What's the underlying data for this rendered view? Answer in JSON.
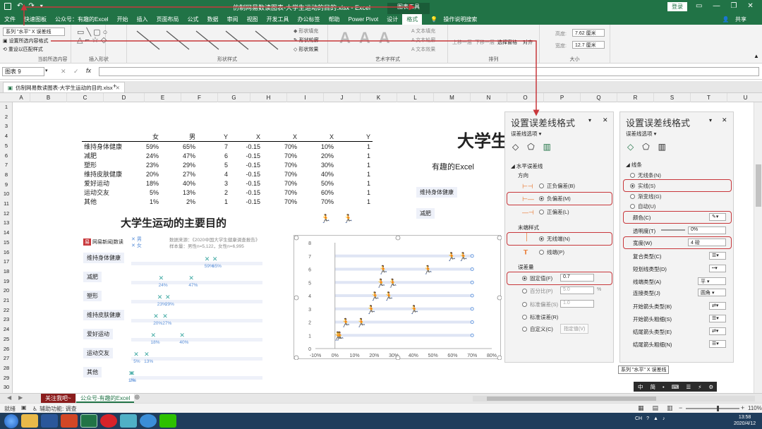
{
  "window": {
    "title": "仿制网易数读图表-大学生运动的目的.xlsx  -  Excel",
    "context_tab": "图表工具",
    "login": "登录",
    "share": "共享"
  },
  "menu": [
    "文件",
    "快速图板",
    "公众号：有趣的Excel",
    "开始",
    "插入",
    "页面布局",
    "公式",
    "数据",
    "审阅",
    "视图",
    "开发工具",
    "办公标签",
    "帮助",
    "Power Pivot",
    "设计",
    "格式",
    "操作说明搜索"
  ],
  "menu_active": "格式",
  "ribbon": {
    "selector": "系列 \"水平\" X 误差线",
    "sel_btn1": "设置所选内容格式",
    "sel_btn2": "重设以匹配样式",
    "grp_sel": "当前所选内容",
    "grp_insert": "插入形状",
    "grp_shape_style": "形状样式",
    "grp_art": "艺术字样式",
    "grp_arrange": "排列",
    "grp_size": "大小",
    "fill": "形状填充",
    "outline": "形状轮廓",
    "effect": "形状效果",
    "text_fill": "文本填充",
    "text_outline": "文本轮廓",
    "text_effect": "文本效果",
    "up": "上移一层",
    "down": "下移一层",
    "pane": "选择窗格",
    "align": "对齐",
    "height": "7.62 厘米",
    "width": "12.7 厘米",
    "h_lab": "高度:",
    "w_lab": "宽度:"
  },
  "namebox": "图表 9",
  "fx": "fx",
  "filetab": "仿制网易数读图表-大学生运动的目的.xlsx",
  "columns": [
    "A",
    "B",
    "C",
    "D",
    "E",
    "F",
    "G",
    "H",
    "I",
    "J",
    "K",
    "L",
    "M",
    "N",
    "O",
    "P",
    "Q",
    "R",
    "S",
    "T",
    "U"
  ],
  "rows": [
    "1",
    "2",
    "3",
    "4",
    "5",
    "6",
    "7",
    "8",
    "9",
    "10",
    "11",
    "12",
    "13",
    "14",
    "15",
    "16",
    "17",
    "18",
    "19",
    "20",
    "21",
    "22",
    "23",
    "24",
    "25",
    "26",
    "27",
    "28",
    "29",
    "30"
  ],
  "table": {
    "headers": [
      "",
      "女",
      "男",
      "Y",
      "X",
      "X",
      "X",
      "Y",
      ""
    ],
    "rows": [
      [
        "维持身体健康",
        "59%",
        "65%",
        "7",
        "-0.15",
        "70%",
        "10%",
        "1"
      ],
      [
        "减肥",
        "24%",
        "47%",
        "6",
        "-0.15",
        "70%",
        "20%",
        "1"
      ],
      [
        "塑形",
        "23%",
        "29%",
        "5",
        "-0.15",
        "70%",
        "30%",
        "1"
      ],
      [
        "维持皮肤健康",
        "20%",
        "27%",
        "4",
        "-0.15",
        "70%",
        "40%",
        "1"
      ],
      [
        "爱好运动",
        "18%",
        "40%",
        "3",
        "-0.15",
        "70%",
        "50%",
        "1"
      ],
      [
        "运动交友",
        "5%",
        "13%",
        "2",
        "-0.15",
        "70%",
        "60%",
        "1"
      ],
      [
        "其他",
        "1%",
        "2%",
        "1",
        "-0.15",
        "70%",
        "70%",
        "1"
      ]
    ]
  },
  "infographic": {
    "title": "大学生运动的主要目的",
    "brand": "网易新闻|数读",
    "legend_m": "男",
    "legend_f": "女",
    "source": "数据来源：《2020中国大学生健康调查报告》",
    "sample": "样本量：男性n=5,122，女性n=6,995",
    "cats": [
      {
        "name": "维持身体健康",
        "f": "59%",
        "m": "65%"
      },
      {
        "name": "减肥",
        "f": "24%",
        "m": "47%"
      },
      {
        "name": "塑形",
        "f": "23%",
        "m": "29%"
      },
      {
        "name": "维持皮肤健康",
        "f": "20%",
        "m": "27%"
      },
      {
        "name": "爱好运动",
        "f": "18%",
        "m": "40%"
      },
      {
        "name": "运动交友",
        "f": "5%",
        "m": "13%"
      },
      {
        "name": "其他",
        "f": "1%",
        "m": "2%"
      }
    ]
  },
  "right_preview": {
    "title": "大学生",
    "subtitle": "有趣的Excel",
    "cats": [
      "维持身体健康",
      "减肥"
    ]
  },
  "chart_data": {
    "type": "scatter",
    "xlim": [
      -0.1,
      0.8
    ],
    "ylim": [
      0,
      8
    ],
    "x_ticks": [
      "-10%",
      "0%",
      "10%",
      "20%",
      "30%",
      "40%",
      "50%",
      "60%",
      "70%",
      "80%"
    ],
    "y_ticks": [
      "0",
      "1",
      "2",
      "3",
      "4",
      "5",
      "6",
      "7",
      "8"
    ],
    "series": [
      {
        "name": "女",
        "x": [
          0.59,
          0.24,
          0.23,
          0.2,
          0.18,
          0.05,
          0.01
        ],
        "y": [
          7,
          6,
          5,
          4,
          3,
          2,
          1
        ]
      },
      {
        "name": "男",
        "x": [
          0.65,
          0.47,
          0.29,
          0.27,
          0.4,
          0.13,
          0.02
        ],
        "y": [
          7,
          6,
          5,
          4,
          3,
          2,
          1
        ]
      },
      {
        "name": "水平",
        "x": [
          0.7,
          0.7,
          0.7,
          0.7,
          0.7,
          0.7,
          0.7
        ],
        "y": [
          7,
          6,
          5,
          4,
          3,
          2,
          1
        ],
        "error_x_minus": 0.7
      }
    ]
  },
  "pane1": {
    "title": "设置误差线格式",
    "subtitle": "误差线选项",
    "section": "水平误差线",
    "dir": "方向",
    "both": "正负偏差(B)",
    "minus": "负偏差(M)",
    "plus": "正偏差(L)",
    "end": "末端样式",
    "nocap": "无线端(N)",
    "cap": "线端(P)",
    "amount": "误差量",
    "fixed": "固定值(F)",
    "fixed_val": "0.7",
    "pct": "百分比(P)",
    "pct_val": "5.0",
    "pct_unit": "%",
    "std": "标准偏差(S)",
    "std_val": "1.0",
    "se": "标准误差(R)",
    "custom": "自定义(C)",
    "custom_btn": "指定值(V)"
  },
  "pane2": {
    "title": "设置误差线格式",
    "subtitle": "误差线选项",
    "section": "线条",
    "none": "无线条(N)",
    "solid": "实线(S)",
    "grad": "渐变线(G)",
    "auto": "自动(U)",
    "color": "颜色(C)",
    "transp": "透明度(T)",
    "transp_val": "0%",
    "width": "宽度(W)",
    "width_val": "4 磅",
    "compound": "复合类型(C)",
    "dash": "短划线类型(D)",
    "cap": "线端类型(A)",
    "cap_val": "平",
    "join": "连接类型(J)",
    "join_val": "圆角",
    "bs": "开始箭头类型(B)",
    "bsz": "开始箭头粗细(S)",
    "es": "结尾箭头类型(E)",
    "esz": "结尾箭头粗细(N)"
  },
  "tooltip": "系列 \"水平\" X 误差线",
  "sheettabs": [
    "关注我吧~",
    "公众号-有趣的Excel"
  ],
  "status": {
    "ready": "就绪",
    "access": "辅助功能: 调查",
    "zoom": "110%"
  },
  "clock": {
    "time": "13:58",
    "date": "2020/4/12"
  },
  "colors": {
    "excel_green": "#217346",
    "red": "#c8373b",
    "marker_orange": "#e8762c",
    "error_bar": "#dfe5f4"
  }
}
